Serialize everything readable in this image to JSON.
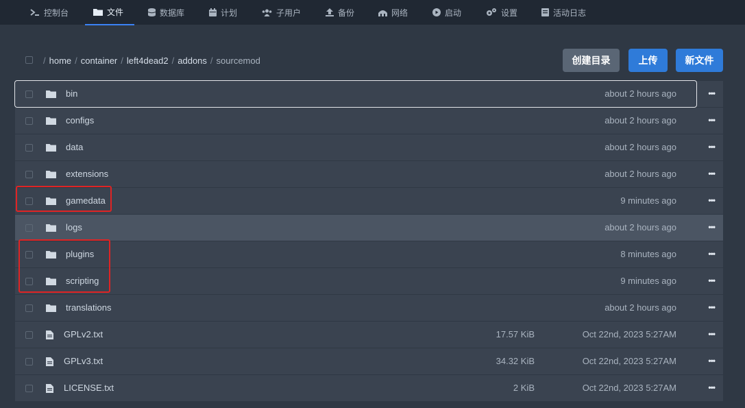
{
  "colors": {
    "accent": "#2f7bd9",
    "annotation": "#e02424",
    "active_underline": "#3b82f6"
  },
  "nav": {
    "items": [
      {
        "label": "控制台",
        "icon": "terminal-icon"
      },
      {
        "label": "文件",
        "icon": "folder-icon",
        "active": true
      },
      {
        "label": "数据库",
        "icon": "database-icon"
      },
      {
        "label": "计划",
        "icon": "calendar-icon"
      },
      {
        "label": "子用户",
        "icon": "users-icon"
      },
      {
        "label": "备份",
        "icon": "upload-icon"
      },
      {
        "label": "网络",
        "icon": "network-icon"
      },
      {
        "label": "启动",
        "icon": "play-icon"
      },
      {
        "label": "设置",
        "icon": "gears-icon"
      },
      {
        "label": "活动日志",
        "icon": "log-icon"
      }
    ]
  },
  "breadcrumb": {
    "root_sep": "/",
    "parts": [
      "home",
      "container",
      "left4dead2",
      "addons"
    ],
    "current": "sourcemod"
  },
  "actions": {
    "create_dir": "创建目录",
    "upload": "上传",
    "new_file": "新文件"
  },
  "files": [
    {
      "name": "bin",
      "type": "folder",
      "size": "",
      "modified": "about 2 hours ago"
    },
    {
      "name": "configs",
      "type": "folder",
      "size": "",
      "modified": "about 2 hours ago"
    },
    {
      "name": "data",
      "type": "folder",
      "size": "",
      "modified": "about 2 hours ago"
    },
    {
      "name": "extensions",
      "type": "folder",
      "size": "",
      "modified": "about 2 hours ago"
    },
    {
      "name": "gamedata",
      "type": "folder",
      "size": "",
      "modified": "9 minutes ago"
    },
    {
      "name": "logs",
      "type": "folder",
      "size": "",
      "modified": "about 2 hours ago"
    },
    {
      "name": "plugins",
      "type": "folder",
      "size": "",
      "modified": "8 minutes ago"
    },
    {
      "name": "scripting",
      "type": "folder",
      "size": "",
      "modified": "9 minutes ago"
    },
    {
      "name": "translations",
      "type": "folder",
      "size": "",
      "modified": "about 2 hours ago"
    },
    {
      "name": "GPLv2.txt",
      "type": "file",
      "size": "17.57 KiB",
      "modified": "Oct 22nd, 2023 5:27AM"
    },
    {
      "name": "GPLv3.txt",
      "type": "file",
      "size": "34.32 KiB",
      "modified": "Oct 22nd, 2023 5:27AM"
    },
    {
      "name": "LICENSE.txt",
      "type": "file",
      "size": "2 KiB",
      "modified": "Oct 22nd, 2023 5:27AM"
    }
  ],
  "more_glyph": "•••"
}
